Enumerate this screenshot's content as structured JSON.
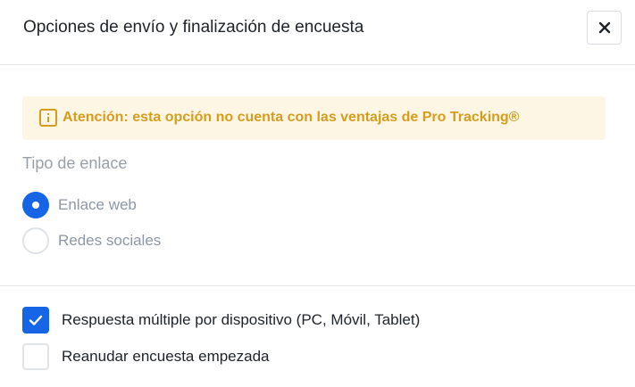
{
  "dialog": {
    "title": "Opciones de envío y finalización de encuesta",
    "close_icon": "close-icon"
  },
  "alert": {
    "icon": "info-icon",
    "text": "Atención: esta opción no cuenta con las ventajas de Pro Tracking®",
    "color": "#d59d1f",
    "background": "#fef6e4"
  },
  "link_type": {
    "label": "Tipo de enlace",
    "options": [
      {
        "label": "Enlace web",
        "selected": true
      },
      {
        "label": "Redes sociales",
        "selected": false
      }
    ]
  },
  "options": [
    {
      "label": "Respuesta múltiple por dispositivo (PC, Móvil, Tablet)",
      "checked": true
    },
    {
      "label": "Reanudar encuesta empezada",
      "checked": false
    }
  ],
  "colors": {
    "accent": "#1565e6",
    "text": "#1f2329",
    "muted": "#8d97a5"
  }
}
